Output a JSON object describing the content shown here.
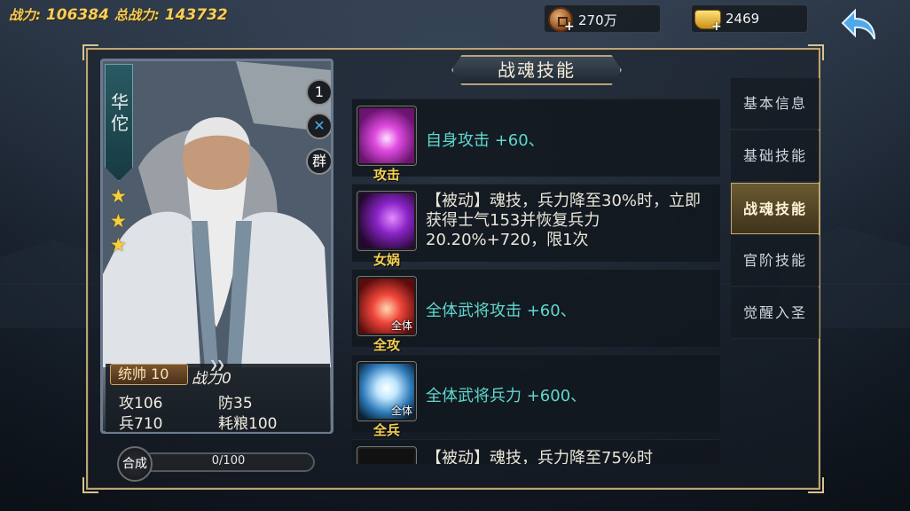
{
  "header": {
    "power_label": "战力:",
    "power_value": "106384",
    "total_power_label": "总战力:",
    "total_power_value": "143732"
  },
  "resources": {
    "copper_value": "270万",
    "gold_value": "2469"
  },
  "card": {
    "name": "华佗",
    "level_badge": "1",
    "faction": "群",
    "stars": 3,
    "lead_label": "统帅 10",
    "power_label": "战力",
    "power_value": "0",
    "attack_label": "攻",
    "attack_value": "106",
    "defense_label": "防",
    "defense_value": "35",
    "troops_label": "兵",
    "troops_value": "710",
    "food_label": "耗粮",
    "food_value": "100"
  },
  "synth": {
    "button_label": "合成",
    "progress_text": "0/100",
    "progress": 0
  },
  "panel": {
    "title": "战魂技能"
  },
  "skills": [
    {
      "name": "攻击",
      "badge": "",
      "description": "自身攻击 +60、",
      "icon": "attack-skill-icon"
    },
    {
      "name": "女娲",
      "badge": "",
      "description": "【被动】魂技，兵力降至30%时，立即获得士气153并恢复兵力20.20%+720，限1次",
      "icon": "nuwa-skill-icon"
    },
    {
      "name": "全攻",
      "badge": "全体",
      "description": "全体武将攻击 +60、",
      "icon": "all-attack-skill-icon"
    },
    {
      "name": "全兵",
      "badge": "全体",
      "description": "全体武将兵力 +600、",
      "icon": "all-troops-skill-icon"
    },
    {
      "name": "",
      "badge": "",
      "description": "【被动】魂技，兵力降至75%时",
      "icon": "partial-skill-icon"
    }
  ],
  "tabs": [
    {
      "label": "基本信息",
      "active": false
    },
    {
      "label": "基础技能",
      "active": false
    },
    {
      "label": "战魂技能",
      "active": true
    },
    {
      "label": "官阶技能",
      "active": false
    },
    {
      "label": "觉醒入圣",
      "active": false
    }
  ],
  "colors": {
    "gold_text": "#f4cf5a",
    "skill_desc": "#5fd8cf",
    "frame_border": "#b8a57a"
  }
}
